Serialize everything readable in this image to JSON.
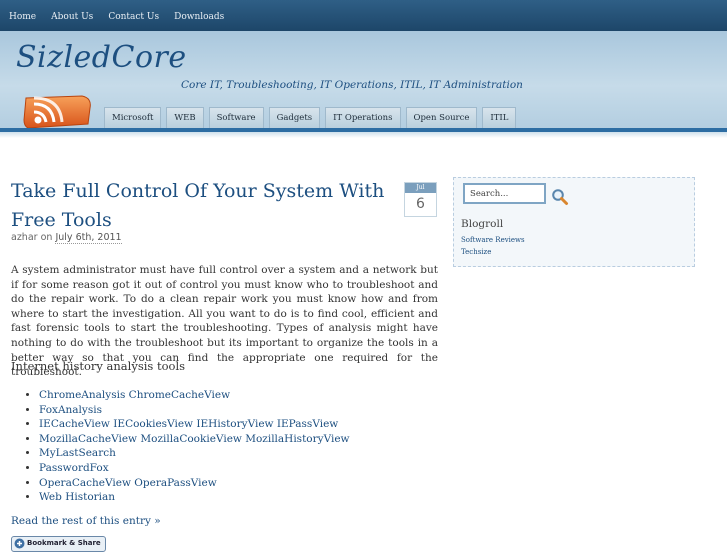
{
  "topnav": [
    "Home",
    "About Us",
    "Contact Us",
    "Downloads"
  ],
  "site": {
    "title": "SizledCore",
    "tagline": "Core IT, Troubleshooting, IT Operations, ITIL, IT Administration"
  },
  "categories": [
    "Microsoft",
    "WEB",
    "Software",
    "Gadgets",
    "IT Operations",
    "Open Source",
    "ITIL"
  ],
  "post": {
    "title": "Take Full Control Of Your System With Free Tools",
    "author": "azhar",
    "on": "on",
    "date": "July 6th, 2011",
    "badge_month": "Jul",
    "badge_day": "6",
    "body": "A system administrator must have full control over a system and a network but if for some reason got it out of control you must know who to troubleshoot and do the repair work. To do a clean repair work you must know how and from where to start the investigation. All you want to do is to find cool, efficient and fast forensic tools to start the troubleshooting. Types of analysis might have nothing to do with the troubleshoot but its important to organize the tools in a better way so that you can find the appropriate one required for the troubleshoot.",
    "subheading": "Internet history analysis tools",
    "tools": [
      "ChromeAnalysis ChromeCacheView",
      "FoxAnalysis",
      "IECacheView IECookiesView IEHistoryView IEPassView",
      "MozillaCacheView MozillaCookieView MozillaHistoryView",
      "MyLastSearch",
      "PasswordFox",
      "OperaCacheView OperaPassView",
      "Web Historian"
    ],
    "read_more": "Read the rest of this entry »",
    "bookmark": "Bookmark & Share"
  },
  "sidebar": {
    "search_value": "Search...",
    "blogroll_title": "Blogroll",
    "blogroll_links": [
      "Software Reviews",
      "Techsize"
    ]
  },
  "icons": {
    "rss": "rss-feed-icon",
    "search": "magnifier-icon"
  }
}
